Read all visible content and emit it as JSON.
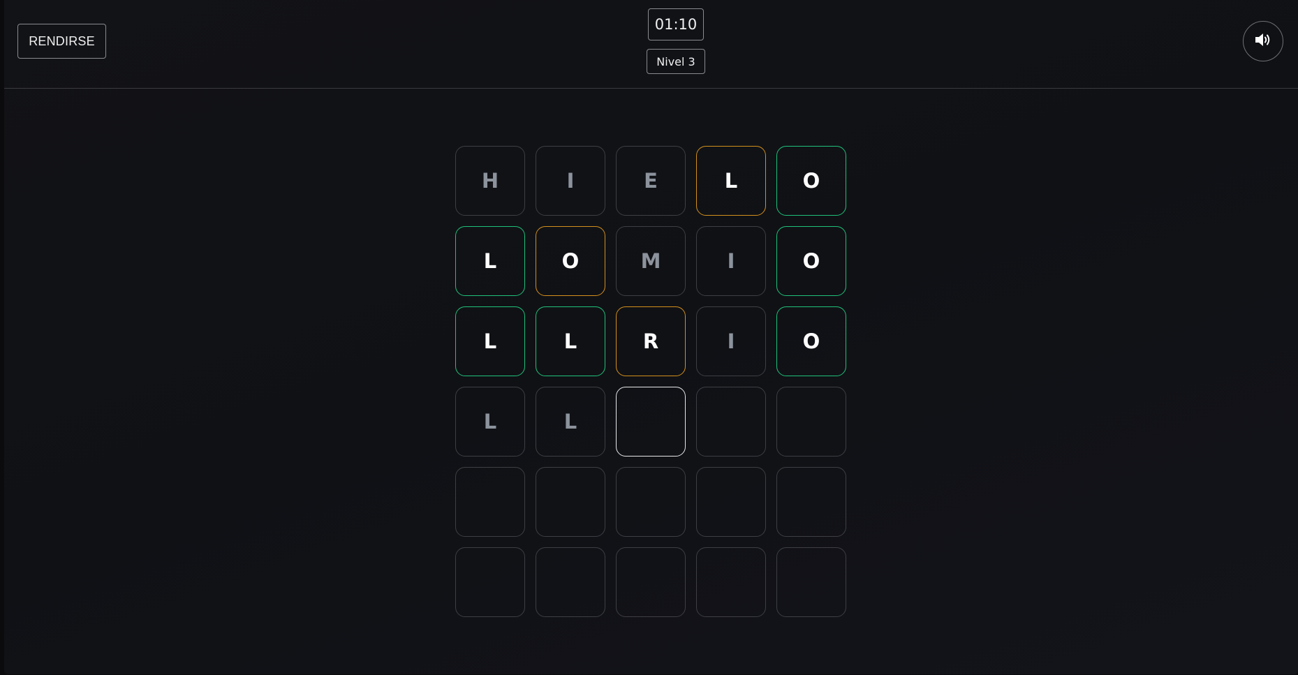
{
  "header": {
    "give_up_label": "RENDIRSE",
    "timer": "01:10",
    "level": "Nivel 3",
    "sound_icon": "volume-icon"
  },
  "colors": {
    "correct": "#1fc27a",
    "present": "#d4901c",
    "absent": "#3e3f44",
    "active": "#e8e8e8",
    "background": "#111216"
  },
  "board": {
    "rows": [
      [
        {
          "letter": "H",
          "state": "absent"
        },
        {
          "letter": "I",
          "state": "absent"
        },
        {
          "letter": "E",
          "state": "absent"
        },
        {
          "letter": "L",
          "state": "present"
        },
        {
          "letter": "O",
          "state": "correct"
        }
      ],
      [
        {
          "letter": "L",
          "state": "correct"
        },
        {
          "letter": "O",
          "state": "present"
        },
        {
          "letter": "M",
          "state": "absent"
        },
        {
          "letter": "I",
          "state": "absent"
        },
        {
          "letter": "O",
          "state": "correct"
        }
      ],
      [
        {
          "letter": "L",
          "state": "correct"
        },
        {
          "letter": "L",
          "state": "correct"
        },
        {
          "letter": "R",
          "state": "present"
        },
        {
          "letter": "I",
          "state": "absent"
        },
        {
          "letter": "O",
          "state": "correct"
        }
      ],
      [
        {
          "letter": "L",
          "state": "typed"
        },
        {
          "letter": "L",
          "state": "typed"
        },
        {
          "letter": "",
          "state": "active"
        },
        {
          "letter": "",
          "state": "empty"
        },
        {
          "letter": "",
          "state": "empty"
        }
      ],
      [
        {
          "letter": "",
          "state": "empty"
        },
        {
          "letter": "",
          "state": "empty"
        },
        {
          "letter": "",
          "state": "empty"
        },
        {
          "letter": "",
          "state": "empty"
        },
        {
          "letter": "",
          "state": "empty"
        }
      ],
      [
        {
          "letter": "",
          "state": "empty"
        },
        {
          "letter": "",
          "state": "empty"
        },
        {
          "letter": "",
          "state": "empty"
        },
        {
          "letter": "",
          "state": "empty"
        },
        {
          "letter": "",
          "state": "empty"
        }
      ]
    ]
  }
}
